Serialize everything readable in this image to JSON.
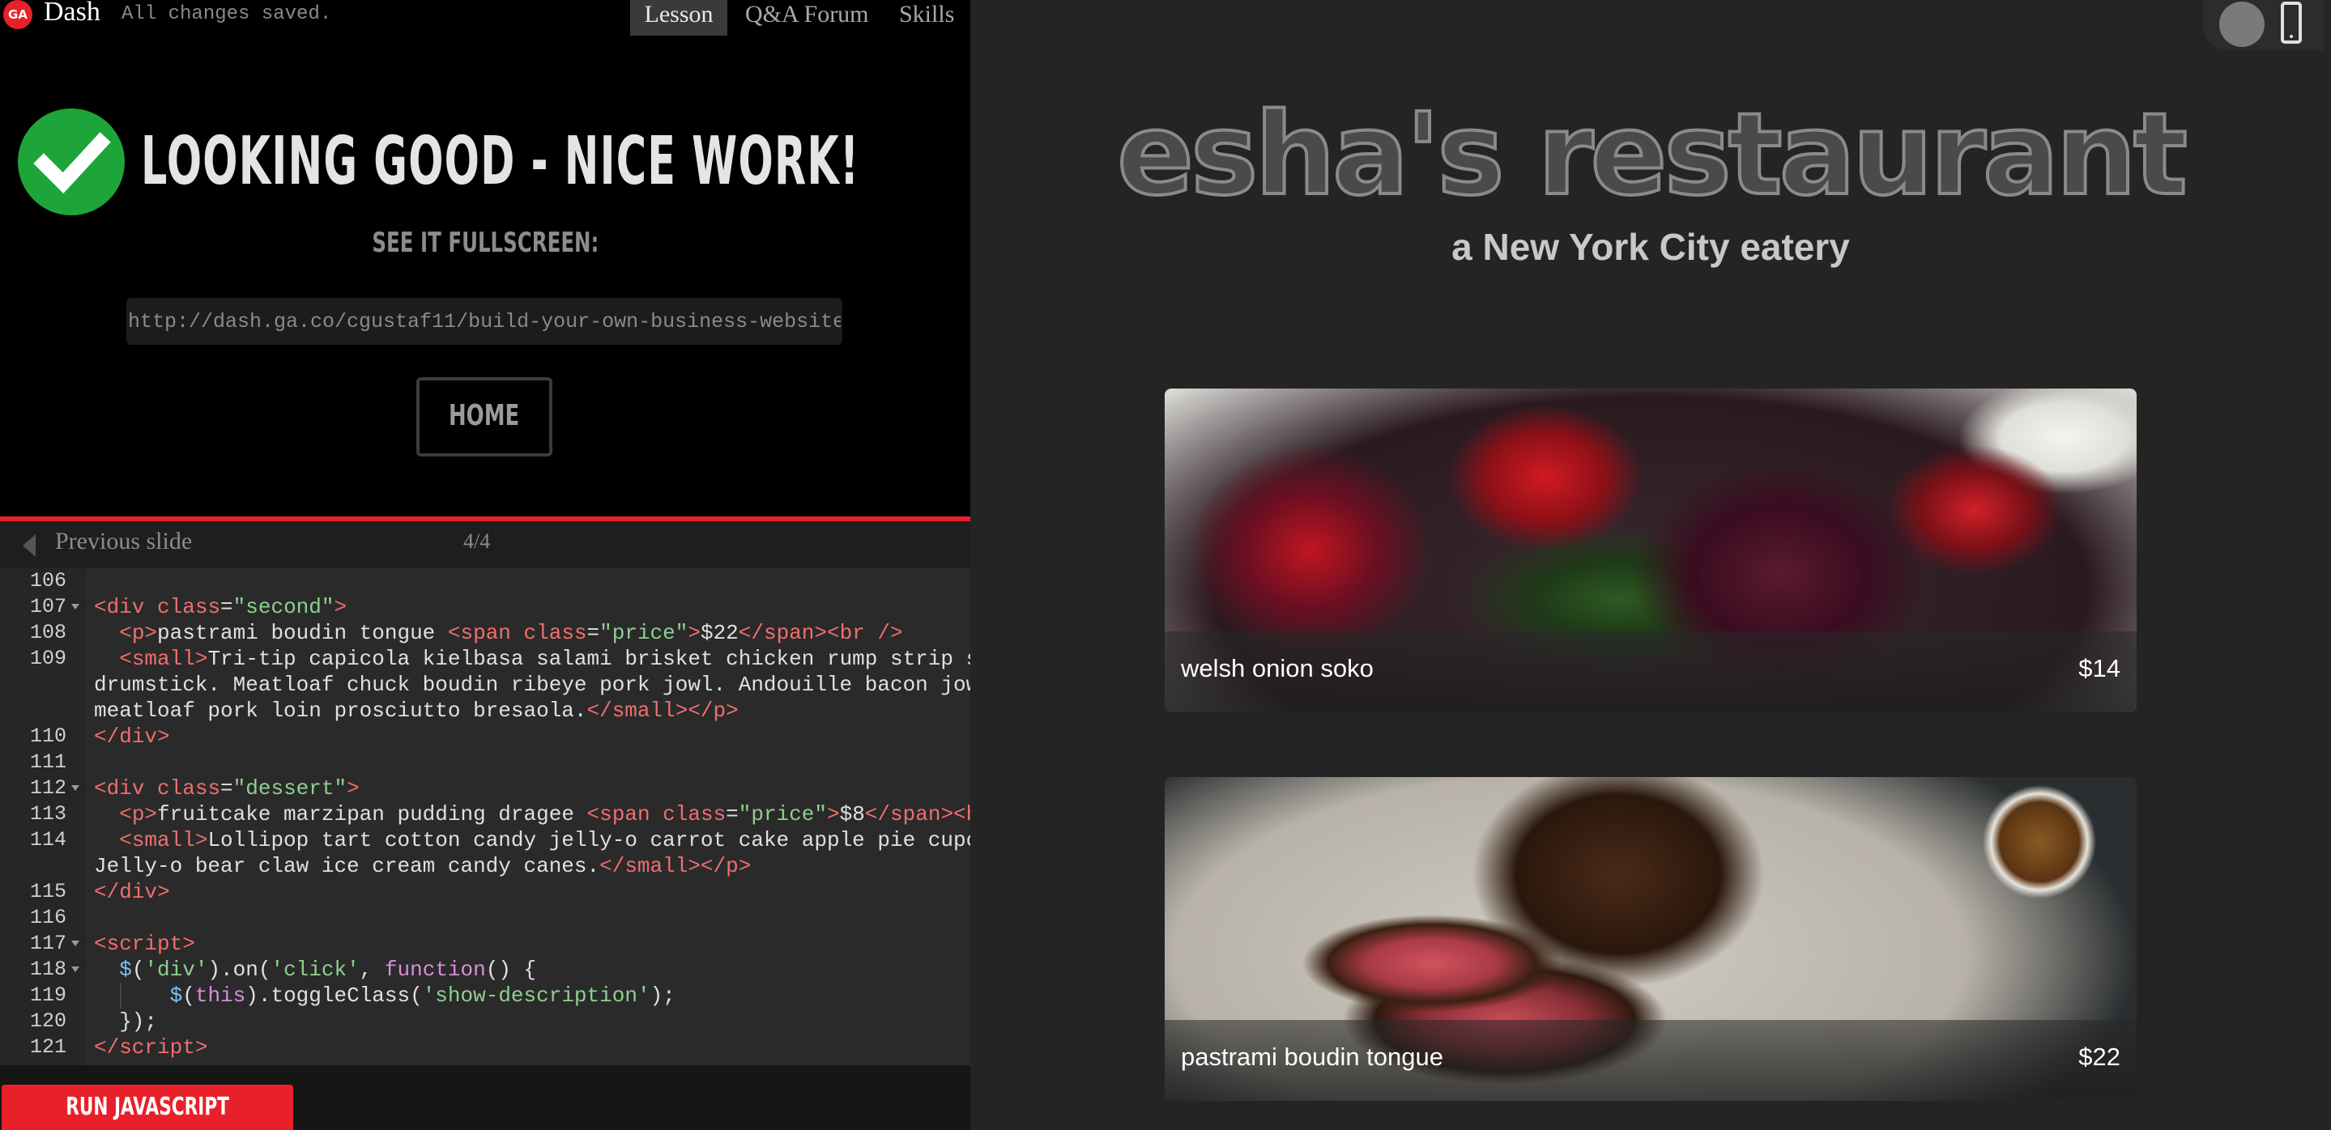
{
  "app": {
    "logo_text": "GA",
    "name": "Dash",
    "save_status": "All changes saved."
  },
  "tabs": [
    {
      "label": "Lesson",
      "active": true
    },
    {
      "label": "Q&A Forum",
      "active": false
    },
    {
      "label": "Skills",
      "active": false
    }
  ],
  "success": {
    "heading": "LOOKING GOOD - NICE WORK!",
    "fullscreen_label": "SEE IT FULLSCREEN:",
    "url": "http://dash.ga.co/cgustaf11/build-your-own-business-website",
    "home_label": "HOME"
  },
  "slides": {
    "prev_label": "Previous slide",
    "count": "4/4"
  },
  "editor": {
    "line_numbers": [
      "106",
      "107",
      "108",
      "109",
      "",
      "",
      "110",
      "111",
      "112",
      "113",
      "114",
      "",
      "115",
      "116",
      "117",
      "118",
      "119",
      "120",
      "121"
    ]
  },
  "run_button": "RUN JAVASCRIPT",
  "preview": {
    "title": "esha's restaurant",
    "subtitle": "a New York City eatery",
    "menu": [
      {
        "name": "welsh onion soko",
        "price": "$14"
      },
      {
        "name": "pastrami boudin tongue",
        "price": "$22"
      }
    ]
  },
  "colors": {
    "brand_red": "#e8202a",
    "success_green": "#1ea53a",
    "editor_bg": "#2a2a2a",
    "preview_bg": "#242424"
  },
  "icons": {
    "logo": "ga-logo-icon",
    "check": "check-circle-icon",
    "prev": "triangle-left-icon",
    "desktop": "desktop-toggle-icon",
    "mobile": "mobile-phone-icon"
  }
}
